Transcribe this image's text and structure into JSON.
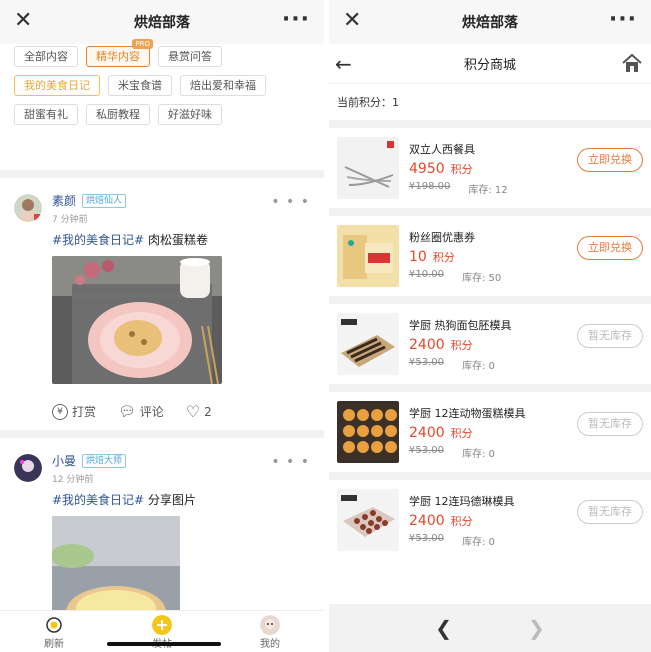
{
  "left": {
    "title": "烘焙部落",
    "close_icon": "close-icon",
    "more_icon": "more-icon",
    "tags": [
      [
        "全部内容",
        "精华内容",
        "悬赏问答"
      ],
      [
        "我的美食日记",
        "米宝食谱",
        "焙出爱和幸福"
      ],
      [
        "甜蜜有礼",
        "私厨教程",
        "好滋好味"
      ]
    ],
    "pro_label": "PRO",
    "posts": [
      {
        "author": "素颜",
        "badge": "烘焙仙人",
        "time": "7 分钟前",
        "hashtag": "#我的美食日记#",
        "text": " 肉松蛋糕卷",
        "actions": {
          "tip": "打赏",
          "comment": "评论",
          "likes": "2"
        }
      },
      {
        "author": "小曼",
        "badge": "烘焙大师",
        "time": "12 分钟前",
        "hashtag": "#我的美食日记#",
        "text": " 分享图片"
      }
    ],
    "tabbar": [
      "刷新",
      "发帖",
      "我的"
    ]
  },
  "right": {
    "title": "烘焙部落",
    "subtitle": "积分商城",
    "points_label": "当前积分：1",
    "products": [
      {
        "name": "双立人西餐具",
        "price": "4950",
        "unit": "积分",
        "old_price": "¥198.00",
        "stock": "库存: 12",
        "button": "立即兑换",
        "available": true
      },
      {
        "name": "粉丝圈优惠券",
        "price": "10",
        "unit": "积分",
        "old_price": "¥10.00",
        "stock": "库存: 50",
        "button": "立即兑换",
        "available": true
      },
      {
        "name": "学厨 热狗面包胚模具",
        "price": "2400",
        "unit": "积分",
        "old_price": "¥53.00",
        "stock": "库存: 0",
        "button": "暂无库存",
        "available": false
      },
      {
        "name": "学厨 12连动物蛋糕模具",
        "price": "2400",
        "unit": "积分",
        "old_price": "¥53.00",
        "stock": "库存: 0",
        "button": "暂无库存",
        "available": false
      },
      {
        "name": "学厨 12连玛德琳模具",
        "price": "2400",
        "unit": "积分",
        "old_price": "¥53.00",
        "stock": "库存: 0",
        "button": "暂无库存",
        "available": false
      }
    ]
  },
  "colors": {
    "accent": "#e87a3a",
    "price": "#e8472a",
    "link": "#2f5597"
  }
}
